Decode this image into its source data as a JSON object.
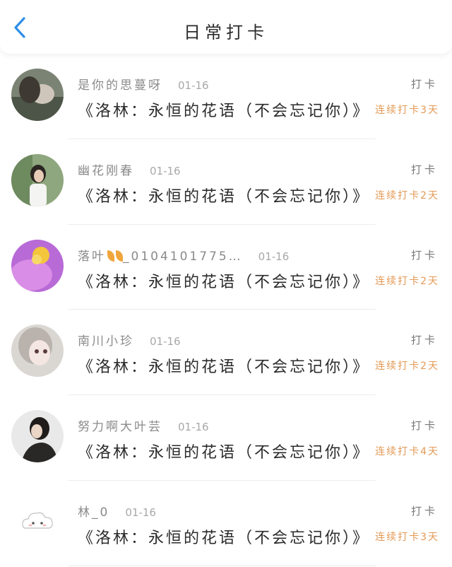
{
  "header": {
    "title": "日常打卡"
  },
  "icons": {
    "back": "chevron-left-icon"
  },
  "colors": {
    "accent": "#2f8ee6",
    "streak": "#e39a56"
  },
  "entries": [
    {
      "username": "是你的思蔓呀",
      "date": "01-16",
      "book": "《洛林：永恒的花语（不会忘记你）》",
      "checkin_label": "打卡",
      "streak": "连续打卡3天"
    },
    {
      "username": "幽花刚春",
      "date": "01-16",
      "book": "《洛林：永恒的花语（不会忘记你）》",
      "checkin_label": "打卡",
      "streak": "连续打卡2天"
    },
    {
      "username": "落叶",
      "username_suffix": "_0104101775…",
      "date": "01-16",
      "book": "《洛林：永恒的花语（不会忘记你）》",
      "checkin_label": "打卡",
      "streak": "连续打卡2天"
    },
    {
      "username": "南川小珍",
      "date": "01-16",
      "book": "《洛林：永恒的花语（不会忘记你）》",
      "checkin_label": "打卡",
      "streak": "连续打卡2天"
    },
    {
      "username": "努力啊大叶芸",
      "date": "01-16",
      "book": "《洛林：永恒的花语（不会忘记你）》",
      "checkin_label": "打卡",
      "streak": "连续打卡4天"
    },
    {
      "username": "林_0",
      "date": "01-16",
      "book": "《洛林：永恒的花语（不会忘记你）》",
      "checkin_label": "打卡",
      "streak": "连续打卡3天"
    }
  ]
}
